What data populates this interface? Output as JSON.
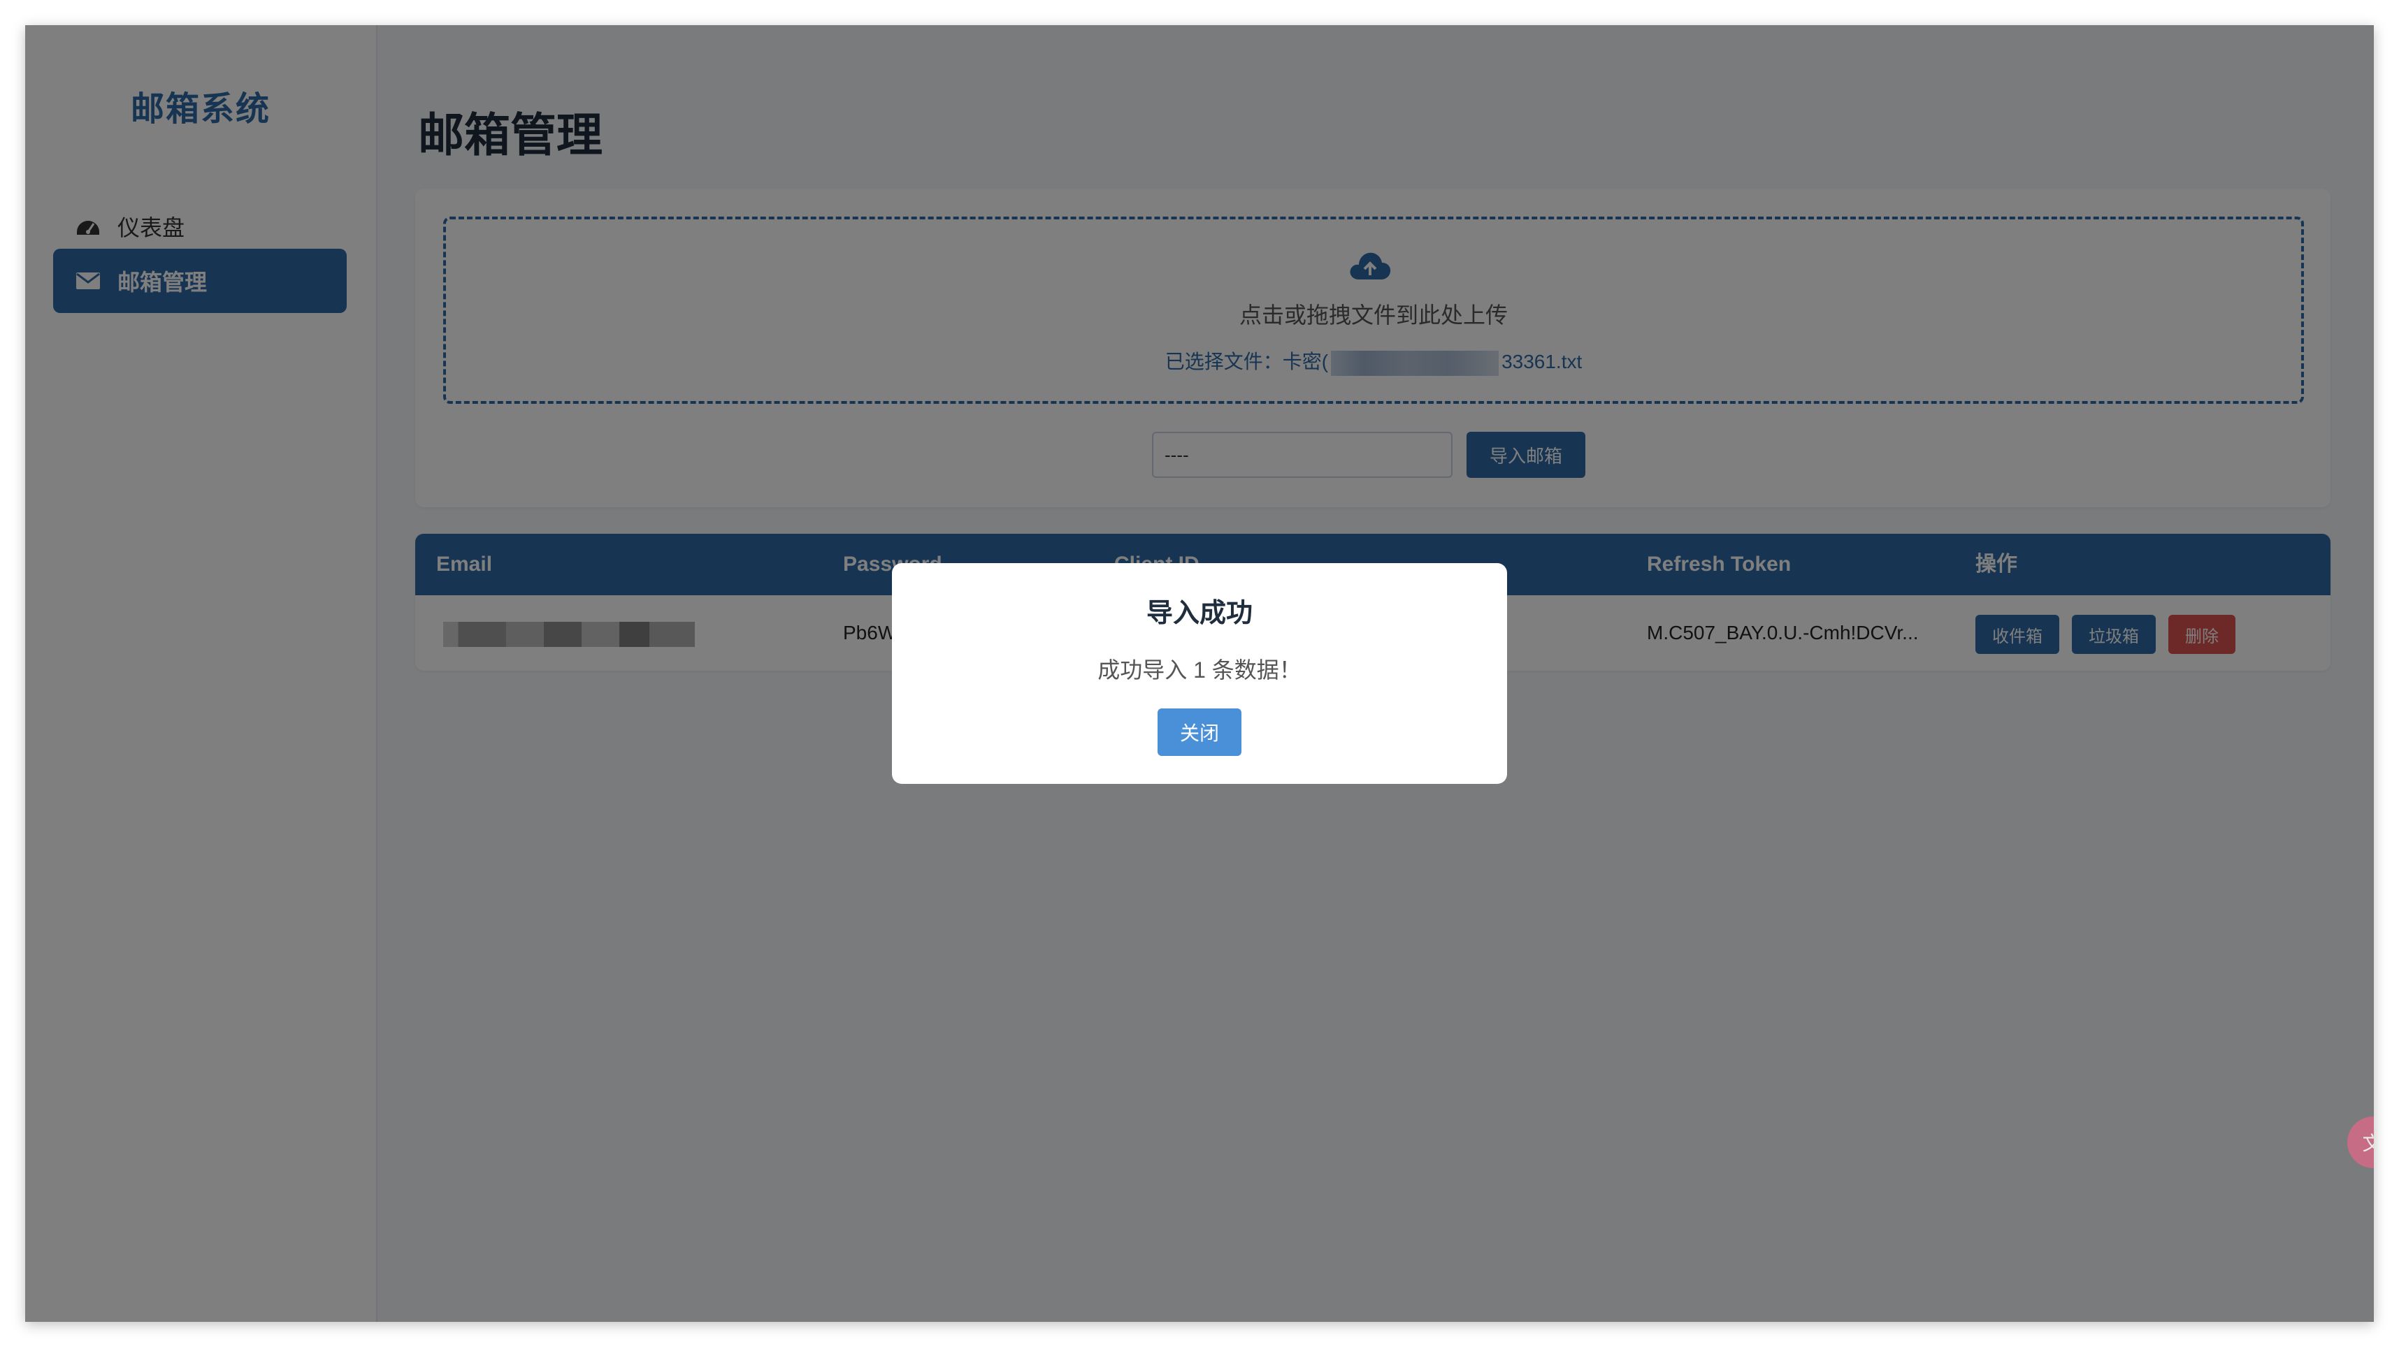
{
  "sidebar": {
    "brand": "邮箱系统",
    "items": [
      {
        "label": "仪表盘",
        "icon": "gauge-icon"
      },
      {
        "label": "邮箱管理",
        "icon": "envelope-icon",
        "active": true
      }
    ]
  },
  "main": {
    "title": "邮箱管理",
    "upload": {
      "hint": "点击或拖拽文件到此处上传",
      "chosen_prefix": "已选择文件：卡密(",
      "chosen_suffix": "33361.txt",
      "separator_value": "----",
      "import_button": "导入邮箱"
    },
    "table": {
      "headers": [
        "Email",
        "Password",
        "Client ID",
        "Refresh Token",
        "操作"
      ],
      "rows": [
        {
          "password": "Pb6W",
          "refresh_token": "M.C507_BAY.0.U.-Cmh!DCVr...",
          "actions": [
            "收件箱",
            "垃圾箱",
            "删除"
          ]
        }
      ]
    }
  },
  "modal": {
    "title": "导入成功",
    "message": "成功导入 1 条数据！",
    "close": "关闭"
  },
  "translate_fab": "文A",
  "colors": {
    "primary": "#2f6aa7",
    "danger": "#d9534f",
    "modal_button": "#4a90d9"
  }
}
